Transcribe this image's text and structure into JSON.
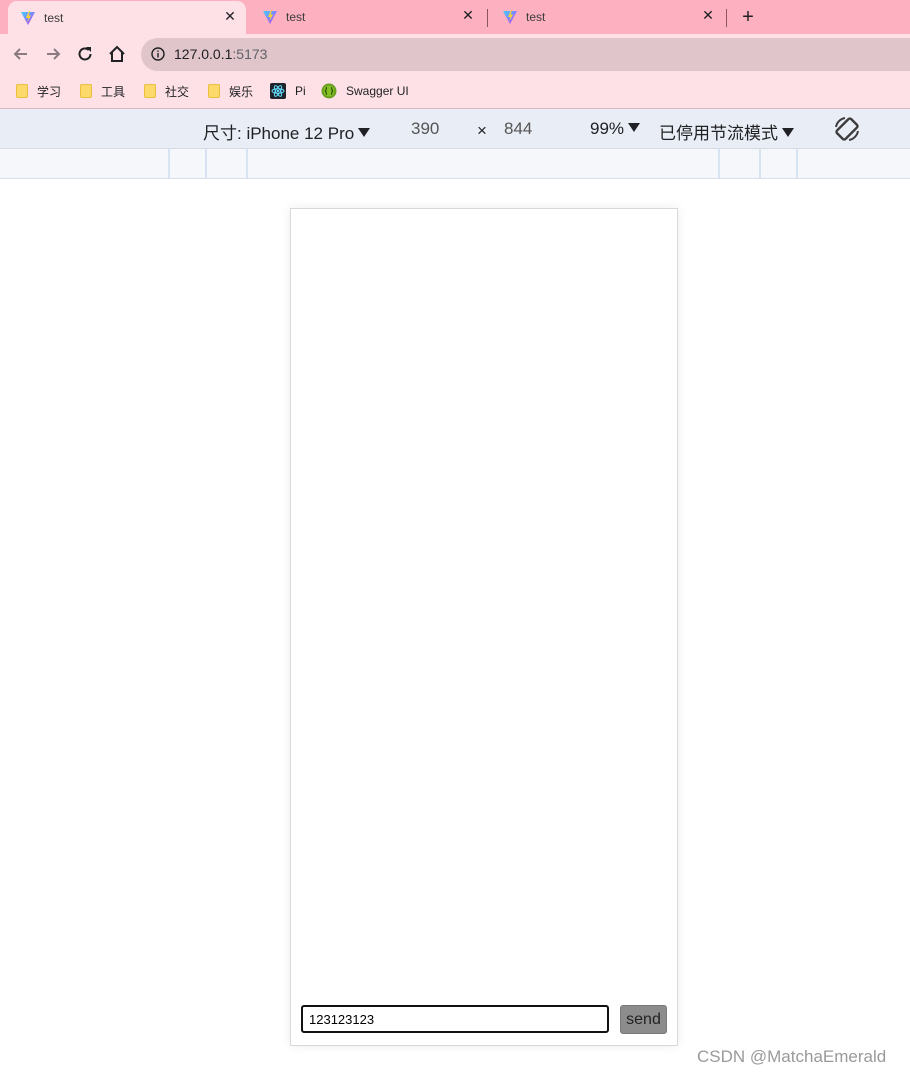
{
  "tabs": [
    {
      "title": "test",
      "favicon": "vite-icon",
      "active": true
    },
    {
      "title": "test",
      "favicon": "vite-icon",
      "active": false
    },
    {
      "title": "test",
      "favicon": "vite-icon",
      "active": false
    }
  ],
  "new_tab": "+",
  "close_glyph": "✕",
  "address_bar": {
    "host": "127.0.0.1",
    "port": ":5173"
  },
  "bookmarks": [
    {
      "label": "学习",
      "icon": "folder-icon"
    },
    {
      "label": "工具",
      "icon": "folder-icon"
    },
    {
      "label": "社交",
      "icon": "folder-icon"
    },
    {
      "label": "娱乐",
      "icon": "folder-icon"
    },
    {
      "label": "Pi",
      "icon": "react-icon"
    },
    {
      "label": "Swagger UI",
      "icon": "swagger-icon"
    }
  ],
  "device_toolbar": {
    "dimensions_label": "尺寸: iPhone 12 Pro",
    "width": "390",
    "times": "×",
    "height": "844",
    "zoom": "99%",
    "throttling": "已停用节流模式"
  },
  "chat": {
    "input_value": "123123123",
    "send_label": "send"
  },
  "watermark": "CSDN @MatchaEmerald",
  "colors": {
    "tab_strip": "#fdb0bf",
    "toolbar": "#fde1e6",
    "device_bar": "#e9edf5",
    "send_button": "#8c8c8c"
  }
}
